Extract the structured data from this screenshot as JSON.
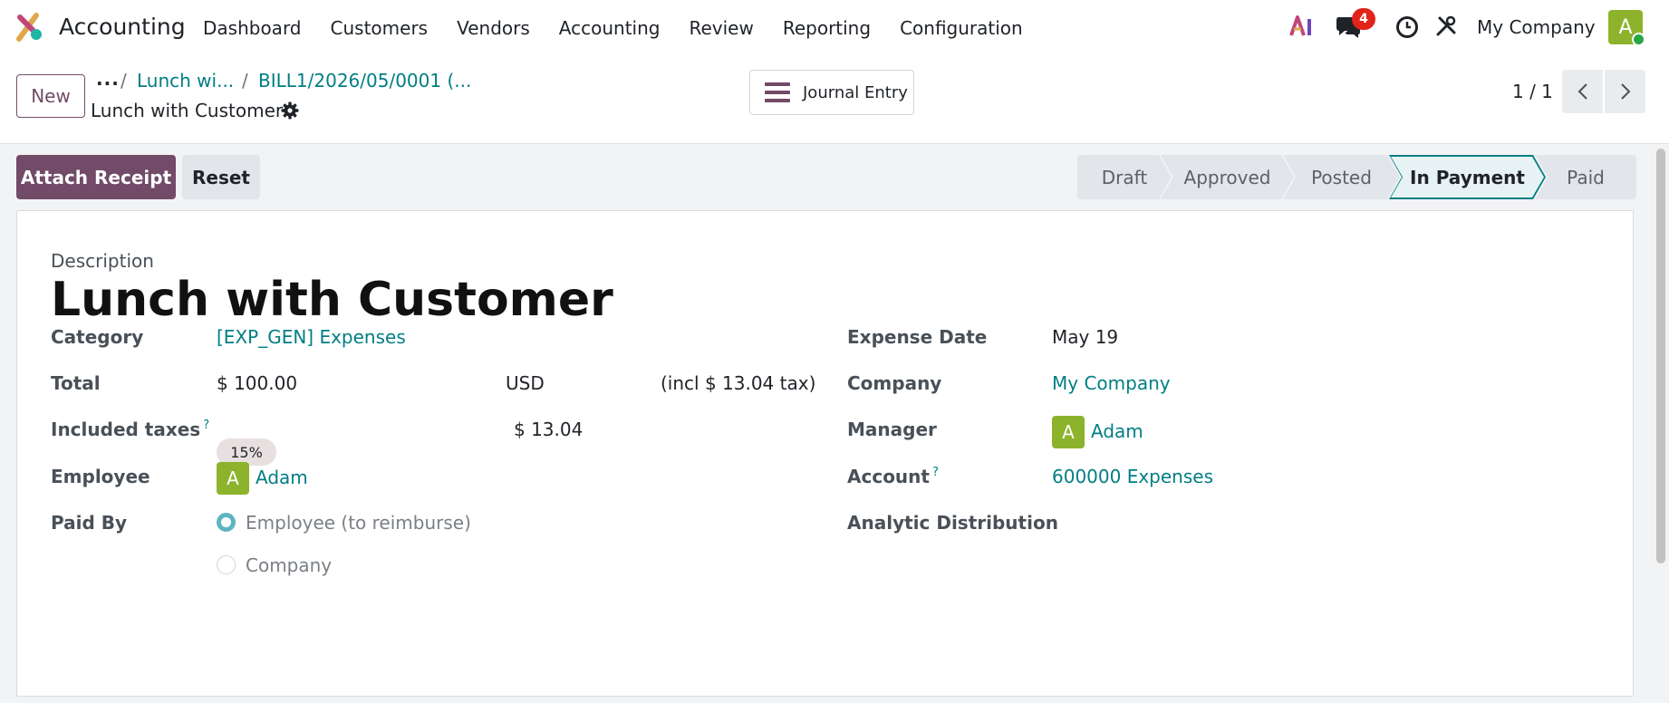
{
  "app": {
    "name": "Accounting"
  },
  "menu": [
    "Dashboard",
    "Customers",
    "Vendors",
    "Accounting",
    "Review",
    "Reporting",
    "Configuration"
  ],
  "nav": {
    "chat_count": "4",
    "company": "My Company",
    "user_initial": "A"
  },
  "control": {
    "new_label": "New",
    "breadcrumb_more": "...",
    "breadcrumb": [
      "Lunch wi...",
      "BILL1/2026/05/0001 (..."
    ],
    "record_title": "Lunch with Customer",
    "journal_entry_label": "Journal Entry",
    "pager": "1 / 1"
  },
  "actions": {
    "attach": "Attach Receipt",
    "reset": "Reset"
  },
  "stages": [
    "Draft",
    "Approved",
    "Posted",
    "In Payment",
    "Paid"
  ],
  "active_stage": "In Payment",
  "form": {
    "description_label": "Description",
    "description": "Lunch with Customer",
    "left": {
      "category_label": "Category",
      "category": "[EXP_GEN] Expenses",
      "total_label": "Total",
      "total": "$ 100.00",
      "currency": "USD",
      "tax_note": "(incl $ 13.04 tax)",
      "included_taxes_label": "Included taxes",
      "help_mark": "?",
      "tax_tag": "15%",
      "tax_amount": "$ 13.04",
      "employee_label": "Employee",
      "employee": "Adam",
      "employee_initial": "A",
      "paid_by_label": "Paid By",
      "paid_by_options": [
        "Employee (to reimburse)",
        "Company"
      ],
      "paid_by_selected": "Employee (to reimburse)"
    },
    "right": {
      "expense_date_label": "Expense Date",
      "expense_date": "May 19",
      "company_label": "Company",
      "company": "My Company",
      "manager_label": "Manager",
      "manager": "Adam",
      "manager_initial": "A",
      "account_label": "Account",
      "account": "600000 Expenses",
      "analytic_label": "Analytic Distribution"
    }
  },
  "colors": {
    "brand": "#714b67",
    "link": "#017e84",
    "avatar": "#8db32c",
    "badge": "#e2231a"
  }
}
